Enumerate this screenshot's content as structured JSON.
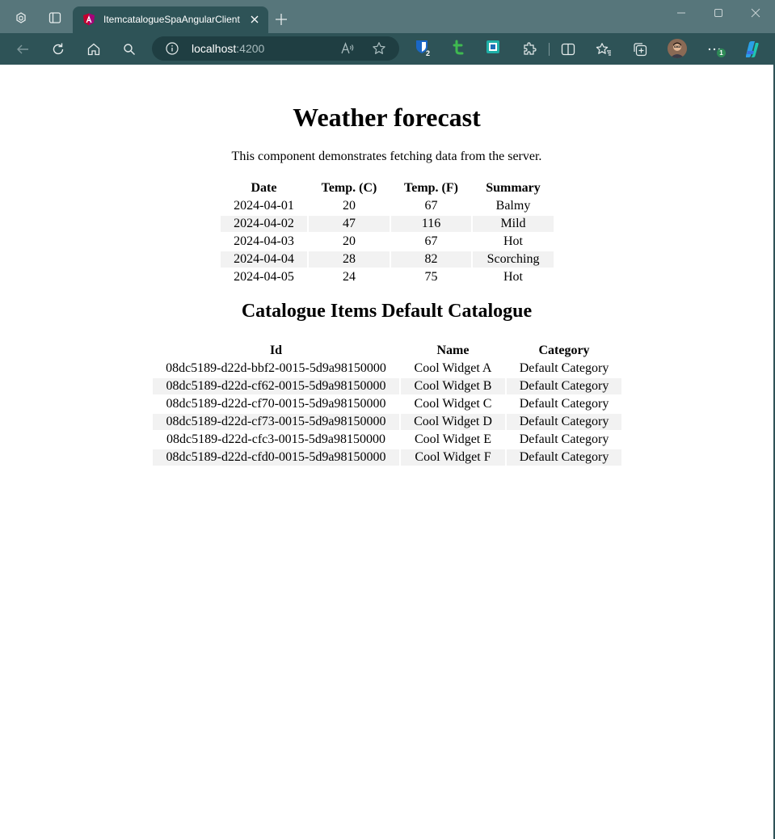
{
  "browser": {
    "tab_title": "ItemcatalogueSpaAngularClient",
    "address_host": "localhost",
    "address_port": ":4200",
    "extension_badge_1": "2",
    "more_badge": "1",
    "icons": [
      "workspaces-icon",
      "tab-actions-icon",
      "angular-favicon-icon",
      "close-icon",
      "new-tab-icon",
      "minimize-icon",
      "maximize-icon",
      "window-close-icon",
      "back-icon",
      "refresh-icon",
      "home-icon",
      "search-icon",
      "info-icon",
      "read-aloud-icon",
      "favorite-star-icon",
      "bitwarden-extension-icon",
      "t-extension-icon",
      "extension-app-icon",
      "extensions-puzzle-icon",
      "split-screen-icon",
      "favorites-icon",
      "collections-icon",
      "profile-avatar",
      "more-icon",
      "copilot-icon"
    ],
    "accent_colors": {
      "titlebar": "#57767b",
      "toolbar": "#2e5357",
      "addressbar": "#1f3e42"
    }
  },
  "weather": {
    "title": "Weather forecast",
    "intro": "This component demonstrates fetching data from the server.",
    "headers": [
      "Date",
      "Temp. (C)",
      "Temp. (F)",
      "Summary"
    ],
    "rows": [
      [
        "2024-04-01",
        "20",
        "67",
        "Balmy"
      ],
      [
        "2024-04-02",
        "47",
        "116",
        "Mild"
      ],
      [
        "2024-04-03",
        "20",
        "67",
        "Hot"
      ],
      [
        "2024-04-04",
        "28",
        "82",
        "Scorching"
      ],
      [
        "2024-04-05",
        "24",
        "75",
        "Hot"
      ]
    ]
  },
  "catalogue": {
    "title": "Catalogue Items Default Catalogue",
    "headers": [
      "Id",
      "Name",
      "Category"
    ],
    "rows": [
      [
        "08dc5189-d22d-bbf2-0015-5d9a98150000",
        "Cool Widget A",
        "Default Category"
      ],
      [
        "08dc5189-d22d-cf62-0015-5d9a98150000",
        "Cool Widget B",
        "Default Category"
      ],
      [
        "08dc5189-d22d-cf70-0015-5d9a98150000",
        "Cool Widget C",
        "Default Category"
      ],
      [
        "08dc5189-d22d-cf73-0015-5d9a98150000",
        "Cool Widget D",
        "Default Category"
      ],
      [
        "08dc5189-d22d-cfc3-0015-5d9a98150000",
        "Cool Widget E",
        "Default Category"
      ],
      [
        "08dc5189-d22d-cfd0-0015-5d9a98150000",
        "Cool Widget F",
        "Default Category"
      ]
    ]
  }
}
